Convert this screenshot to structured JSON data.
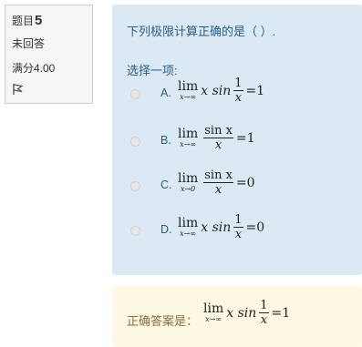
{
  "info": {
    "question_label": "题目",
    "question_number": "5",
    "status": "未回答",
    "mark": "满分4.00",
    "flag_icon": "flag-icon"
  },
  "question": {
    "text": "下列极限计算正确的是（    ）.",
    "prompt": "选择一项:",
    "options": [
      {
        "letter": "A.",
        "lim_sub": "x→∞",
        "pre": "x sin",
        "num": "1",
        "den": "x",
        "rhs": "=1"
      },
      {
        "letter": "B.",
        "lim_sub": "x→∞",
        "pre": "",
        "num": "sin x",
        "den": "x",
        "rhs": "=1"
      },
      {
        "letter": "C.",
        "lim_sub": "x→0",
        "pre": "",
        "num": "sin x",
        "den": "x",
        "rhs": "=0"
      },
      {
        "letter": "D.",
        "lim_sub": "x→∞",
        "pre": "x sin",
        "num": "1",
        "den": "x",
        "rhs": "=0"
      }
    ]
  },
  "answer": {
    "label": "正确答案是：",
    "lim_sub": "x→∞",
    "pre": "x sin",
    "num": "1",
    "den": "x",
    "rhs": "=1"
  },
  "lim_word": "lim",
  "colors": {
    "question_bg": "#dbe9f5",
    "answer_bg": "#fcf8e3",
    "info_bg": "#f5f5f5"
  }
}
